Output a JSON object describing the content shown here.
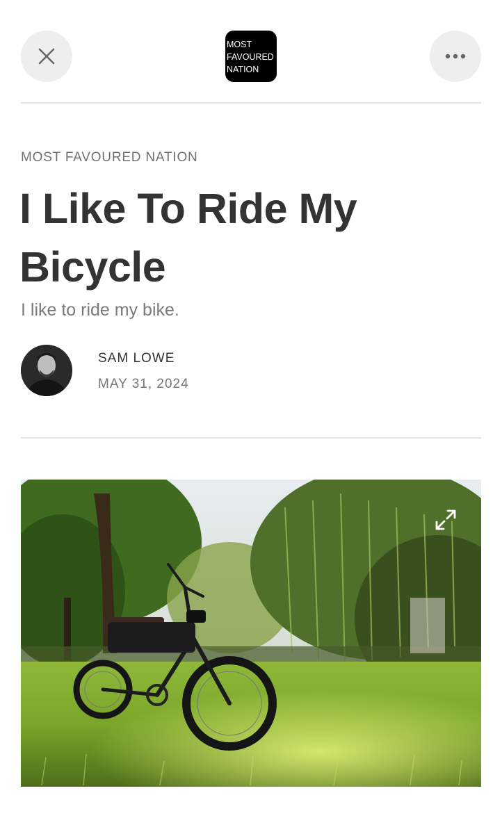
{
  "header": {
    "close_icon": "close-icon",
    "more_icon": "more-horizontal-icon",
    "logo_lines": [
      "MOST",
      "FAVOURED",
      "NATION"
    ]
  },
  "article": {
    "publication": "MOST FAVOURED NATION",
    "title": "I Like To Ride My Bicycle",
    "subtitle": "I like to ride my bike.",
    "author": "SAM LOWE",
    "date": "MAY 31, 2024",
    "hero_image_icon": "expand-icon"
  },
  "colors": {
    "background": "#ffffff",
    "text": "#333333",
    "muted": "#757575",
    "button_bg": "#eeeeee",
    "divider": "#e3e3e3"
  }
}
